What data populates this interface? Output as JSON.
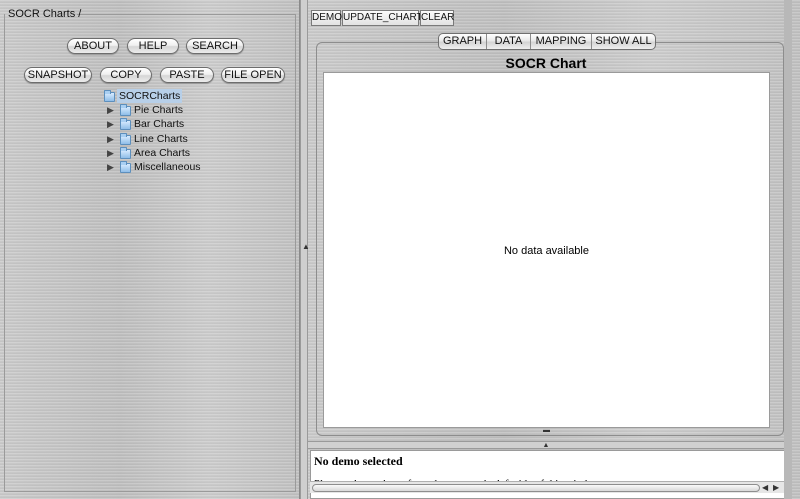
{
  "left": {
    "title": "SOCR Charts /",
    "buttons_row1": [
      "ABOUT",
      "HELP",
      "SEARCH"
    ],
    "buttons_row2": [
      "SNAPSHOT",
      "COPY",
      "PASTE",
      "FILE OPEN"
    ],
    "tree": {
      "root": "SOCRCharts",
      "children": [
        "Pie Charts",
        "Bar Charts",
        "Line Charts",
        "Area Charts",
        "Miscellaneous"
      ]
    }
  },
  "toolbar": [
    "DEMO",
    "UPDATE_CHART",
    "CLEAR"
  ],
  "tabs": [
    "GRAPH",
    "DATA",
    "MAPPING",
    "SHOW ALL"
  ],
  "chart": {
    "title": "SOCR Chart",
    "empty_message": "No data available"
  },
  "info": {
    "title": "No demo selected",
    "text": "Please select a demo from the tree on the left side of this window."
  },
  "icons": {
    "tree_expand": "triangle-right-icon",
    "folder": "folder-icon",
    "splitter": "caret-up-icon"
  }
}
